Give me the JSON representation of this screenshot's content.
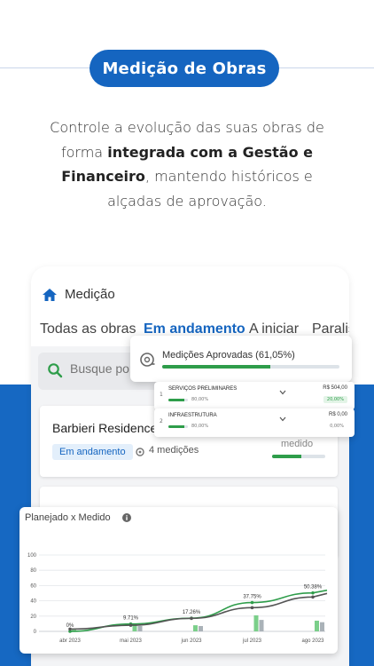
{
  "banner": {
    "title": "Medição de Obras"
  },
  "intro": {
    "line1": "Controle a evolução das suas obras de",
    "line2_pre": "forma ",
    "line2_bold": "integrada com a Gestão e",
    "line3_bold": "Financeiro",
    "line3_post": ", mantendo históricos e",
    "line4": "alçadas de aprovação."
  },
  "app": {
    "title": "Medição",
    "tabs": [
      {
        "label": "Todas as obras"
      },
      {
        "label": "Em andamento"
      },
      {
        "label": "A iniciar"
      },
      {
        "label": "Paralis"
      }
    ],
    "search": {
      "placeholder": "Busque por o"
    },
    "cards": [
      {
        "title": "Barbieri Residence",
        "status": "Em andamento",
        "measurements": "4 medições",
        "medido_label": "medido",
        "progress": 0.55
      },
      {
        "title": ""
      }
    ]
  },
  "popup": {
    "label": "Medições Aprovadas (61,05%)",
    "progress": 0.6105,
    "rows": [
      {
        "num": "1",
        "name": "SERVIÇOS PRELIMINARES",
        "pct": "80,00%",
        "progress": 0.8,
        "value": "R$ 504,00",
        "tag": "20,00%"
      },
      {
        "num": "2",
        "name": "INFRAESTRUTURA",
        "pct": "80,00%",
        "progress": 0.8,
        "value": "R$ 0,00",
        "tag": "0,00%"
      }
    ]
  },
  "chart": {
    "title": "Planejado x Medido"
  },
  "chart_data": {
    "type": "line",
    "title": "Planejado x Medido",
    "categories": [
      "abr 2023",
      "mai 2023",
      "jun 2023",
      "jul 2023",
      "ago 2023"
    ],
    "ylim": [
      0,
      100
    ],
    "yticks": [
      0,
      20,
      40,
      60,
      80,
      100
    ],
    "series": [
      {
        "type": "line",
        "color": "#2e9d4a",
        "values": [
          0,
          9.71,
          17.26,
          37.75,
          50.38
        ]
      },
      {
        "type": "line",
        "color": "#555555",
        "values": [
          3,
          8,
          17,
          31,
          45
        ]
      },
      {
        "type": "bar",
        "color": "#7bcf8a",
        "values": [
          2,
          10,
          8,
          21,
          14
        ]
      },
      {
        "type": "bar",
        "color": "#aab2b8",
        "values": [
          0,
          7,
          7,
          15,
          12
        ]
      }
    ],
    "data_labels": [
      "0%",
      "9.71%",
      "17.26%",
      "37.75%",
      "50.38%"
    ],
    "grid": true,
    "colors": {
      "accent": "#1565c0",
      "measured": "#2e9d4a",
      "planned": "#555555"
    }
  }
}
